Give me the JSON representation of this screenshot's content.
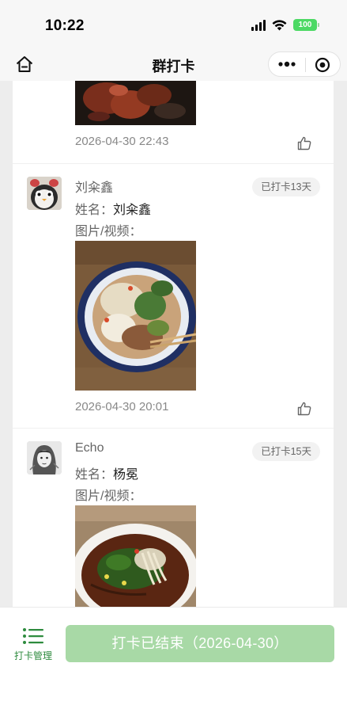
{
  "status_bar": {
    "time": "10:22",
    "battery": "100"
  },
  "nav": {
    "title": "群打卡"
  },
  "posts": [
    {
      "timestamp": "2026-04-30 22:43"
    },
    {
      "username": "刘籴鑫",
      "badge": "已打卡13天",
      "name_label": "姓名：",
      "name_value": "刘籴鑫",
      "media_label": "图片/视频：",
      "timestamp": "2026-04-30 20:01"
    },
    {
      "username": "Echo",
      "badge": "已打卡15天",
      "name_label": "姓名：",
      "name_value": "杨冕",
      "media_label": "图片/视频："
    }
  ],
  "bottom": {
    "manage_label": "打卡管理",
    "ended_label": "打卡已结束（2026-04-30）"
  },
  "colors": {
    "accent_green": "#2e8b3e",
    "button_disabled_green": "#a8d9a6",
    "battery_green": "#4cd964"
  },
  "icons": [
    "home-icon",
    "more-icon",
    "target-icon",
    "thumbs-up-icon",
    "list-icon"
  ]
}
